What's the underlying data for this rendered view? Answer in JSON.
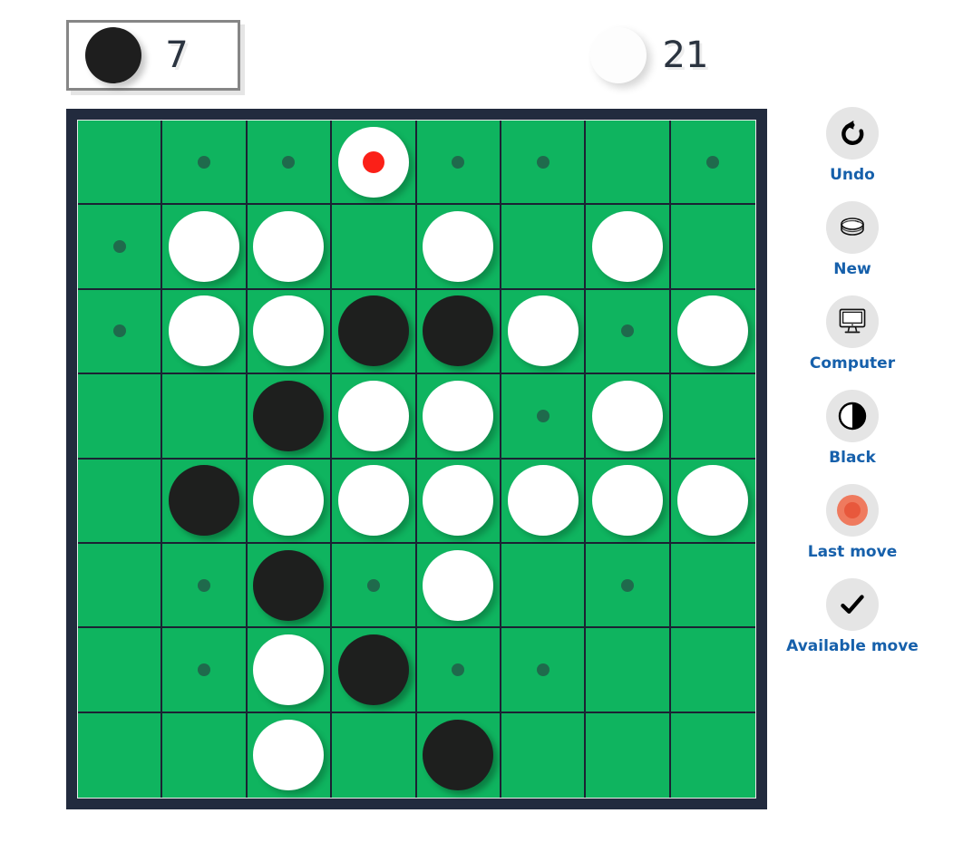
{
  "scoreboard": {
    "black": {
      "disc": "black-disc",
      "score": "7",
      "active": true
    },
    "white": {
      "disc": "white-disc",
      "score": "21",
      "active": false
    }
  },
  "board": {
    "size": 8,
    "colors": {
      "cell": "#0fb45f",
      "frame": "#222b3e",
      "grid_line": "#1b2233",
      "black_disc": "#1e1f1e",
      "white_disc": "#ffffff",
      "last_move_marker": "#fb2018",
      "hint_dot": "#1f6a4c"
    },
    "legend": {
      "empty": "",
      "black": "B",
      "white": "W",
      "hint": "h",
      "white_last": "WL"
    },
    "cells": [
      [
        "",
        "h",
        "h",
        "WL",
        "h",
        "h",
        "",
        "h"
      ],
      [
        "h",
        "W",
        "W",
        "",
        "W",
        "",
        "W",
        ""
      ],
      [
        "h",
        "W",
        "W",
        "B",
        "B",
        "W",
        "h",
        "W"
      ],
      [
        "",
        "",
        "B",
        "W",
        "W",
        "h",
        "W",
        ""
      ],
      [
        "",
        "B",
        "W",
        "W",
        "W",
        "W",
        "W",
        "W"
      ],
      [
        "",
        "h",
        "B",
        "h",
        "W",
        "",
        "h",
        ""
      ],
      [
        "",
        "h",
        "W",
        "B",
        "h",
        "h",
        "",
        ""
      ],
      [
        "",
        "",
        "W",
        "",
        "B",
        "",
        "",
        ""
      ]
    ]
  },
  "sidebar": {
    "buttons": [
      {
        "label": "Undo",
        "icon": "undo-arrow-icon"
      },
      {
        "label": "New",
        "icon": "disc-stack-icon"
      },
      {
        "label": "Computer",
        "icon": "monitor-icon"
      },
      {
        "label": "Black",
        "icon": "contrast-circle-icon"
      },
      {
        "label": "Last move",
        "icon": "last-move-dot-icon"
      },
      {
        "label": "Available move",
        "icon": "checkmark-icon"
      }
    ],
    "label_color": "#1660ab",
    "icon_bg": "#e5e5e5"
  }
}
